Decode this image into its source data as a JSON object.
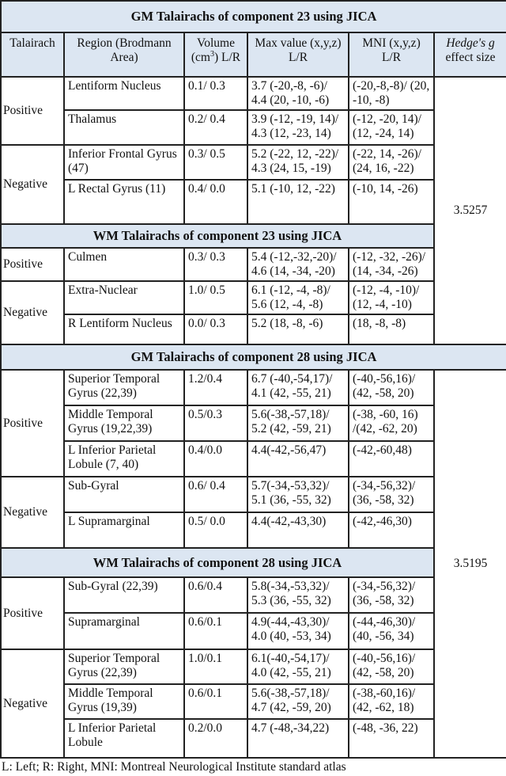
{
  "headers": {
    "talairach": "Talairach",
    "region": "Region (Brodmann Area)",
    "volume_prefix": "Volume (cm",
    "volume_sup": "3",
    "volume_suffix": ") L/R",
    "max_value": "Max value (x,y,z) L/R",
    "mni": "MNI (x,y,z) L/R",
    "hedge_italic": "Hedge's g",
    "hedge_rest": "effect size"
  },
  "sections": [
    {
      "effect": "3.5257",
      "blocks": [
        {
          "title": "GM Talairachs of component 23 using JICA",
          "groups": [
            {
              "sign": "Positive",
              "rows": [
                {
                  "region": "Lentiform Nucleus",
                  "volume": "0.1/ 0.3",
                  "max": "3.7 (-20,-8, -6)/ 4.4 (20, -10, -6)",
                  "mni": "(-20,-8,-8)/ (20, -10, -8)"
                },
                {
                  "region": "Thalamus",
                  "volume": "0.2/ 0.4",
                  "max": "3.9 (-12, -19, 14)/ 4.3 (12, -23, 14)",
                  "mni": "(-12, -20, 14)/ (12, -24, 14)"
                }
              ]
            },
            {
              "sign": "Negative",
              "rows": [
                {
                  "region": "Inferior Frontal Gyrus (47)",
                  "volume": "0.3/ 0.5",
                  "max": "5.2 (-22, 12, -22)/ 4.3 (24, 15, -19)",
                  "mni": "(-22, 14, -26)/ (24, 16, -22)"
                },
                {
                  "region": "L Rectal Gyrus (11)",
                  "volume": "0.4/ 0.0",
                  "max": "5.1 (-10, 12, -22)",
                  "mni": "(-10, 14, -26)"
                }
              ]
            }
          ]
        },
        {
          "title": "WM Talairachs of component 23 using JICA",
          "groups": [
            {
              "sign": "Positive",
              "rows": [
                {
                  "region": "Culmen",
                  "volume": "0.3/ 0.3",
                  "max": "5.4 (-12,-32,-20)/ 4.6 (14, -34, -20)",
                  "mni": "(-12, -32, -26)/ (14, -34, -26)"
                }
              ]
            },
            {
              "sign": "Negative",
              "rows": [
                {
                  "region": "Extra-Nuclear",
                  "volume": "1.0/ 0.5",
                  "max": "6.1 (-12, -4, -8)/ 5.6 (12, -4, -8)",
                  "mni": "(-12, -4, -10)/ (12, -4, -10)"
                },
                {
                  "region": "R Lentiform Nucleus",
                  "volume": "0.0/ 0.3",
                  "max": "5.2 (18, -8, -6)",
                  "mni": "(18, -8, -8)"
                }
              ]
            }
          ]
        }
      ]
    },
    {
      "effect": "3.5195",
      "blocks": [
        {
          "title": "GM Talairachs of component 28 using JICA",
          "groups": [
            {
              "sign": "Positive",
              "rows": [
                {
                  "region": "Superior Temporal Gyrus (22,39)",
                  "volume": "1.2/0.4",
                  "max": "6.7 (-40,-54,17)/ 4.1 (42, -55, 21)",
                  "mni": "(-40,-56,16)/ (42, -58, 20)"
                },
                {
                  "region": "Middle Temporal Gyrus (19,22,39)",
                  "volume": "0.5/0.3",
                  "max": "5.6(-38,-57,18)/ 5.2 (42, -59, 21)",
                  "mni": "(-38, -60, 16) /(42, -62, 20)"
                },
                {
                  "region": "L Inferior Parietal Lobule (7, 40)",
                  "volume": "0.4/0.0",
                  "max": "4.4(-42,-56,47)",
                  "mni": "(-42,-60,48)"
                }
              ]
            },
            {
              "sign": "Negative",
              "rows": [
                {
                  "region": "Sub-Gyral",
                  "volume": "0.6/ 0.4",
                  "max": "5.7(-34,-53,32)/ 5.1 (36, -55, 32)",
                  "mni": "(-34,-56,32)/ (36, -58, 32)"
                },
                {
                  "region": "L Supramarginal",
                  "volume": "0.5/ 0.0",
                  "max": "4.4(-42,-43,30)",
                  "mni": "(-42,-46,30)"
                }
              ]
            }
          ]
        },
        {
          "title": "WM Talairachs of component 28 using JICA",
          "groups": [
            {
              "sign": "Positive",
              "rows": [
                {
                  "region": "Sub-Gyral (22,39)",
                  "volume": "0.6/0.4",
                  "max": "5.8(-34,-53,32)/ 5.3 (36, -55, 32)",
                  "mni": "(-34,-56,32)/ (36, -58, 32)"
                },
                {
                  "region": "Supramarginal",
                  "volume": "0.6/0.1",
                  "max": "4.9(-44,-43,30)/ 4.0 (40, -53, 34)",
                  "mni": "(-44,-46,30)/ (40, -56, 34)"
                }
              ]
            },
            {
              "sign": "Negative",
              "rows": [
                {
                  "region": "Superior Temporal Gyrus (22,39)",
                  "volume": "1.0/0.1",
                  "max": "6.1(-40,-54,17)/ 4.0 (42, -55, 21)",
                  "mni": "(-40,-56,16)/ (42, -58, 20)"
                },
                {
                  "region": "Middle Temporal Gyrus (19,39)",
                  "volume": "0.6/0.1",
                  "max": "5.6(-38,-57,18)/ 4.7 (42, -59, 20)",
                  "mni": "(-38,-60,16)/ (42, -62, 18)"
                },
                {
                  "region": "L Inferior Parietal Lobule",
                  "volume": "0.2/0.0",
                  "max": "4.7 (-48,-34,22)",
                  "mni": "(-48, -36, 22)"
                }
              ]
            }
          ]
        }
      ]
    }
  ],
  "footnote": "L: Left; R: Right, MNI: Montreal Neurological Institute standard atlas"
}
